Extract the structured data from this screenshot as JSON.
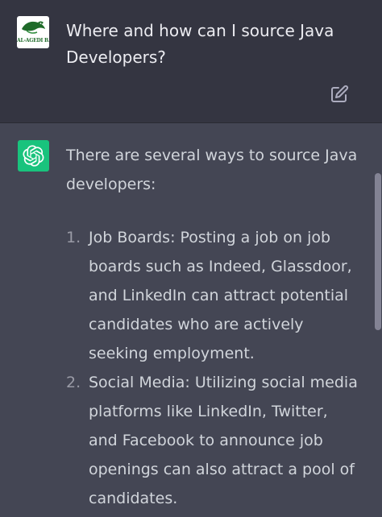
{
  "user_message": {
    "avatar_logo_text": "AL-AGEDI B.C.",
    "text_line1": "Where and how can I source Java",
    "text_line2": "Developers?"
  },
  "assistant_message": {
    "intro_line1": "There are several ways to source Java",
    "intro_line2": "developers:",
    "items": [
      {
        "number": "1.",
        "lines": [
          "Job Boards: Posting a job on job",
          "boards such as Indeed, Glassdoor,",
          "and LinkedIn can attract potential",
          "candidates who are actively",
          "seeking employment."
        ]
      },
      {
        "number": "2.",
        "lines": [
          "Social Media: Utilizing social media",
          "platforms like LinkedIn, Twitter,",
          "and Facebook to announce job",
          "openings can also attract a pool of",
          "candidates."
        ]
      }
    ]
  },
  "icons": {
    "edit": "edit-icon",
    "assistant_logo": "openai-logo-icon"
  },
  "colors": {
    "user_bg": "#343541",
    "assistant_bg": "#444654",
    "assistant_avatar": "#19c37d"
  }
}
